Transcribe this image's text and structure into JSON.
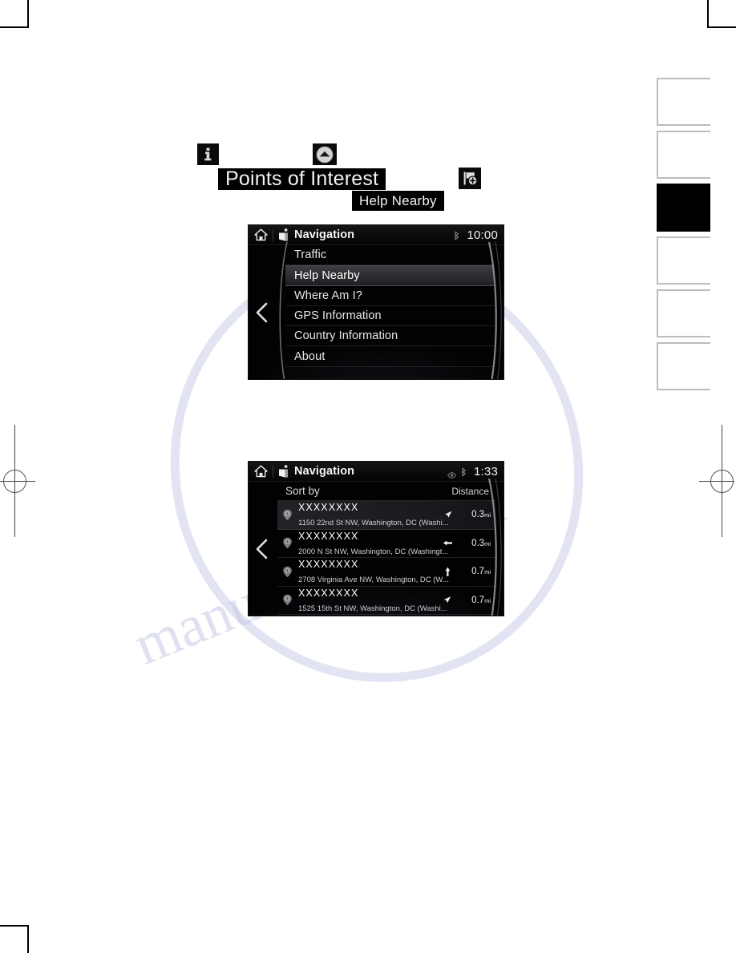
{
  "annotations": {
    "info_icon": "info-icon",
    "up_icon": "chevron-up-circle-icon",
    "flag_icon": "flag-add-icon",
    "poi_label": "Points of Interest",
    "help_nearby_label": "Help Nearby"
  },
  "side_tabs": {
    "count": 6,
    "active_index": 2
  },
  "screen1": {
    "status": {
      "title": "Navigation",
      "clock": "10:00",
      "home_icon": "home-icon",
      "nav_icon": "navigation-icon",
      "bluetooth_icon": "bluetooth-icon"
    },
    "back_icon": "back-chevron-icon",
    "menu": [
      {
        "label": "Traffic",
        "selected": false
      },
      {
        "label": "Help Nearby",
        "selected": true
      },
      {
        "label": "Where Am I?",
        "selected": false
      },
      {
        "label": "GPS Information",
        "selected": false
      },
      {
        "label": "Country Information",
        "selected": false
      },
      {
        "label": "About",
        "selected": false
      }
    ]
  },
  "screen2": {
    "status": {
      "title": "Navigation",
      "clock": "1:33",
      "home_icon": "home-icon",
      "nav_icon": "navigation-icon",
      "eye_icon": "eye-icon",
      "bluetooth_icon": "bluetooth-icon"
    },
    "back_icon": "back-chevron-icon",
    "sort": {
      "label": "Sort by",
      "value": "Distance"
    },
    "results": [
      {
        "name": "XXXXXXXX",
        "address": "1150 22nd St NW, Washington, DC (Washi...",
        "direction": "northeast",
        "distance": "0.3",
        "unit": "mi"
      },
      {
        "name": "XXXXXXXX",
        "address": "2000 N St NW, Washington, DC (Washingt...",
        "direction": "west",
        "distance": "0.3",
        "unit": "mi"
      },
      {
        "name": "XXXXXXXX",
        "address": "2708 Virginia Ave NW, Washington, DC (W...",
        "direction": "north",
        "distance": "0.7",
        "unit": "mi"
      },
      {
        "name": "XXXXXXXX",
        "address": "1525 15th St NW, Washington, DC (Washi...",
        "direction": "southeast",
        "distance": "0.7",
        "unit": "mi"
      }
    ]
  },
  "watermark": {
    "text": "manualslive.com"
  }
}
